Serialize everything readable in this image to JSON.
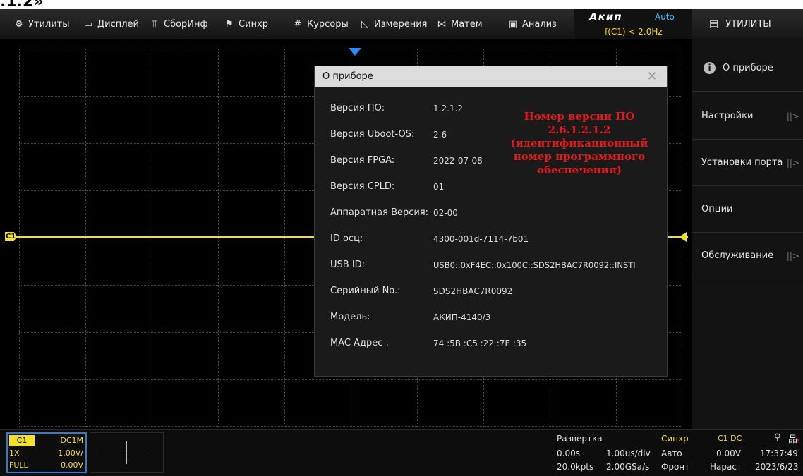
{
  "header_fragment": ".1.2»",
  "menu": [
    {
      "icon": "gear-icon",
      "glyph": "⚙",
      "label": "Утилиты"
    },
    {
      "icon": "display-icon",
      "glyph": "▭",
      "label": "Дисплей"
    },
    {
      "icon": "acquire-icon",
      "glyph": "⫪",
      "label": "СборИнф"
    },
    {
      "icon": "flag-icon",
      "glyph": "⚑",
      "label": "Синхр"
    },
    {
      "icon": "cursors-icon",
      "glyph": "#",
      "label": "Курсоры"
    },
    {
      "icon": "measure-icon",
      "glyph": "◺",
      "label": "Измерения"
    },
    {
      "icon": "math-icon",
      "glyph": "⋈",
      "label": "Матем"
    },
    {
      "icon": "analysis-icon",
      "glyph": "▣",
      "label": "Анализ"
    }
  ],
  "status": {
    "brand": "Акип",
    "trigger_mode": "Auto",
    "trigger_condition": "f(C1) < 2.0Hz"
  },
  "right_panel": {
    "title": "УТИЛИТЫ",
    "title_icon": "document-icon",
    "items": [
      {
        "label": "О приборе",
        "icon": "info-icon",
        "arrow": ""
      },
      {
        "label": "Настройки",
        "arrow": "||>"
      },
      {
        "label": "Установки порта",
        "arrow": "||>"
      },
      {
        "label": "Опции",
        "arrow": ""
      },
      {
        "label": "Обслуживание",
        "arrow": "||>"
      }
    ]
  },
  "dialog": {
    "title": "О приборе",
    "close_glyph": "✕",
    "rows": [
      {
        "label": "Версия ПО:",
        "value": "1.2.1.2"
      },
      {
        "label": "Версия Uboot-OS:",
        "value": "2.6"
      },
      {
        "label": "Версия FPGA:",
        "value": "2022-07-08"
      },
      {
        "label": "Версия CPLD:",
        "value": "01"
      },
      {
        "label": "Аппаратная Версия:",
        "value": "02-00"
      },
      {
        "label": "ID осц:",
        "value": "4300-001d-7114-7b01"
      },
      {
        "label": "USB ID:",
        "value": "USB0::0xF4EC::0x100C::SDS2HBAC7R0092::INSTI"
      },
      {
        "label": "Серийный No.:",
        "value": "SDS2HBAC7R0092"
      },
      {
        "label": "Модель:",
        "value": "АКИП-4140/3"
      },
      {
        "label": "MAC Адрес :",
        "value": "74 :5B :C5 :22 :7E :35"
      }
    ],
    "annotation_lines": [
      "Номер версии ПО",
      "2.6.1.2.1.2",
      "(идентификационный",
      "номер программного",
      "обеспечения)"
    ]
  },
  "channel": {
    "marker": "C1",
    "name": "C1",
    "coupling": "DC1M",
    "probe": "1X",
    "scale": "1.00V/",
    "bandwidth": "FULL",
    "offset": "0.00V"
  },
  "timebase": {
    "title": "Развертка",
    "delay": "0.00s",
    "scale": "1.00us/div",
    "points": "20.0kpts",
    "rate": "2.00GSa/s"
  },
  "trigger": {
    "title": "Синхр",
    "source": "C1 DC",
    "mode": "Авто",
    "level": "0.00V",
    "edge_label": "Фронт",
    "slope": "Нараст"
  },
  "clock": {
    "time": "17:37:49",
    "date": "2023/6/23"
  }
}
